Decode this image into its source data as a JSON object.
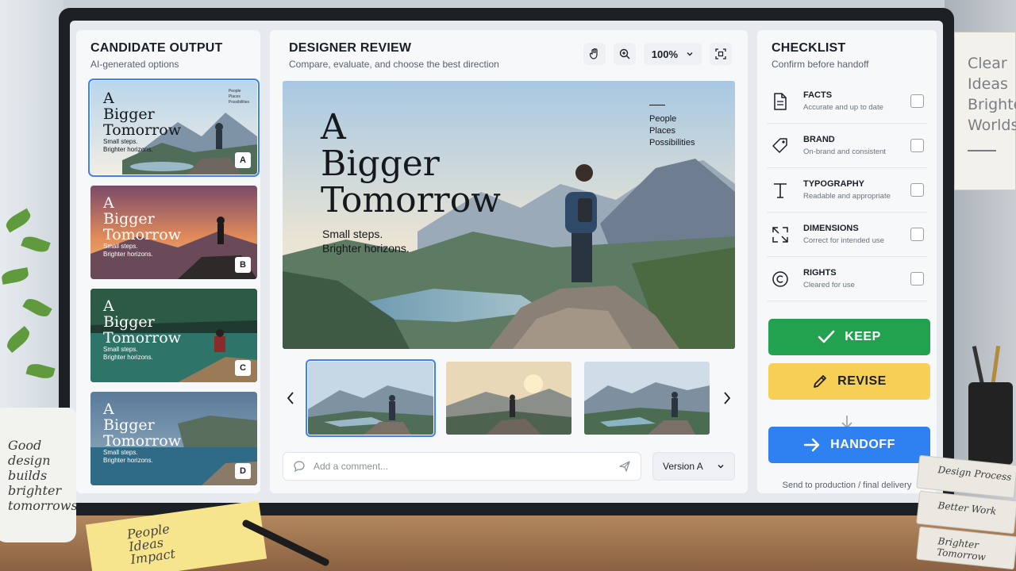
{
  "left_panel": {
    "title": "CANDIDATE OUTPUT",
    "subtitle": "AI-generated options",
    "candidates": [
      {
        "title_lines": [
          "A",
          "Bigger",
          "Tomorrow"
        ],
        "tagline": [
          "Small steps.",
          "Brighter horizons."
        ],
        "badge": "A",
        "mini_list": [
          "People",
          "Places",
          "Possibilities"
        ],
        "selected": true
      },
      {
        "title_lines": [
          "A",
          "Bigger",
          "Tomorrow"
        ],
        "tagline": [
          "Small steps.",
          "Brighter horizons."
        ],
        "badge": "B",
        "selected": false
      },
      {
        "title_lines": [
          "A",
          "Bigger",
          "Tomorrow"
        ],
        "tagline": [
          "Small steps.",
          "Brighter horizons."
        ],
        "badge": "C",
        "selected": false
      },
      {
        "title_lines": [
          "A",
          "Bigger",
          "Tomorrow"
        ],
        "tagline": [
          "Small steps.",
          "Brighter horizons."
        ],
        "badge": "D",
        "selected": false
      }
    ]
  },
  "center_panel": {
    "title": "DESIGNER REVIEW",
    "subtitle": "Compare, evaluate, and choose the best direction",
    "zoom": "100%",
    "hero": {
      "title_lines": [
        "A",
        "Bigger",
        "Tomorrow"
      ],
      "tagline": [
        "Small steps.",
        "Brighter horizons."
      ],
      "list": [
        "People",
        "Places",
        "Possibilities"
      ]
    },
    "comment_placeholder": "Add a comment...",
    "version": "Version A"
  },
  "right_panel": {
    "title": "CHECKLIST",
    "subtitle": "Confirm before handoff",
    "items": [
      {
        "label": "FACTS",
        "desc": "Accurate and up to date",
        "icon": "document-icon",
        "checked": false
      },
      {
        "label": "BRAND",
        "desc": "On-brand and consistent",
        "icon": "tag-icon",
        "checked": false
      },
      {
        "label": "TYPOGRAPHY",
        "desc": "Readable and appropriate",
        "icon": "type-icon",
        "checked": false
      },
      {
        "label": "DIMENSIONS",
        "desc": "Correct for intended use",
        "icon": "resize-icon",
        "checked": false
      },
      {
        "label": "RIGHTS",
        "desc": "Cleared for use",
        "icon": "copyright-icon",
        "checked": false
      }
    ],
    "actions": {
      "keep": "KEEP",
      "revise": "REVISE",
      "handoff": "HANDOFF"
    },
    "handoff_note": "Send to production / final delivery",
    "colors": {
      "keep": "#22a24f",
      "revise": "#f8cf55",
      "handoff": "#2f80f0",
      "accent": "#3b82f6"
    }
  },
  "environment": {
    "wall_sign": [
      "Clear",
      "Ideas",
      "Brighte",
      "Worlds"
    ],
    "mug_text": [
      "Good",
      "design",
      "builds",
      "brighter",
      "tomorrows"
    ],
    "note_text": [
      "People",
      "Ideas",
      "Impact"
    ],
    "books": [
      "Design Process",
      "Better Work",
      "Brighter Tomorrow"
    ]
  }
}
